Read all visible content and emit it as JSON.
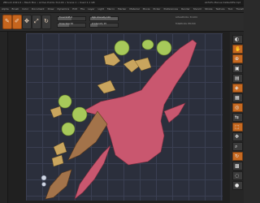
{
  "window": {
    "title": "ZBrush 2021.6 • Mesh Box • Active Points 34,104 • Scene 1 • Used 1.1 GB",
    "right_info": "AC50%  Menus  DefaultZScript"
  },
  "menu": [
    "Alpha",
    "Brush",
    "Color",
    "Document",
    "Draw",
    "Dynamics",
    "Edit",
    "File",
    "Layer",
    "Light",
    "Macro",
    "Marker",
    "Material",
    "Movie",
    "Picker",
    "Preferences",
    "Render",
    "Stencil",
    "Stroke",
    "Texture",
    "Tool",
    "Transform",
    "Zplugin",
    "Zscript",
    "Help"
  ],
  "toolbar": {
    "edit_label": "Edit",
    "draw_label": "Draw",
    "focal_label": "Focal Shift 0",
    "intensity_label": "Draw Size 64",
    "rgb_label": "Rgb Intensity 100",
    "z_label": "Z Intensity 25",
    "active_points_label": "ActivePoints: 34,104",
    "total_points_label": "TotalPoints: 88,340"
  },
  "icons": {
    "edit": "edit-icon",
    "draw": "draw-icon",
    "move": "move-icon",
    "scale": "scale-icon",
    "rotate": "rotate-icon"
  },
  "colors": {
    "accent": "#c6651e",
    "mesh_pink": "#c9576f",
    "mesh_green": "#a7c95a",
    "mesh_brown": "#b5864f",
    "grid_bg": "#2b2f3c"
  }
}
